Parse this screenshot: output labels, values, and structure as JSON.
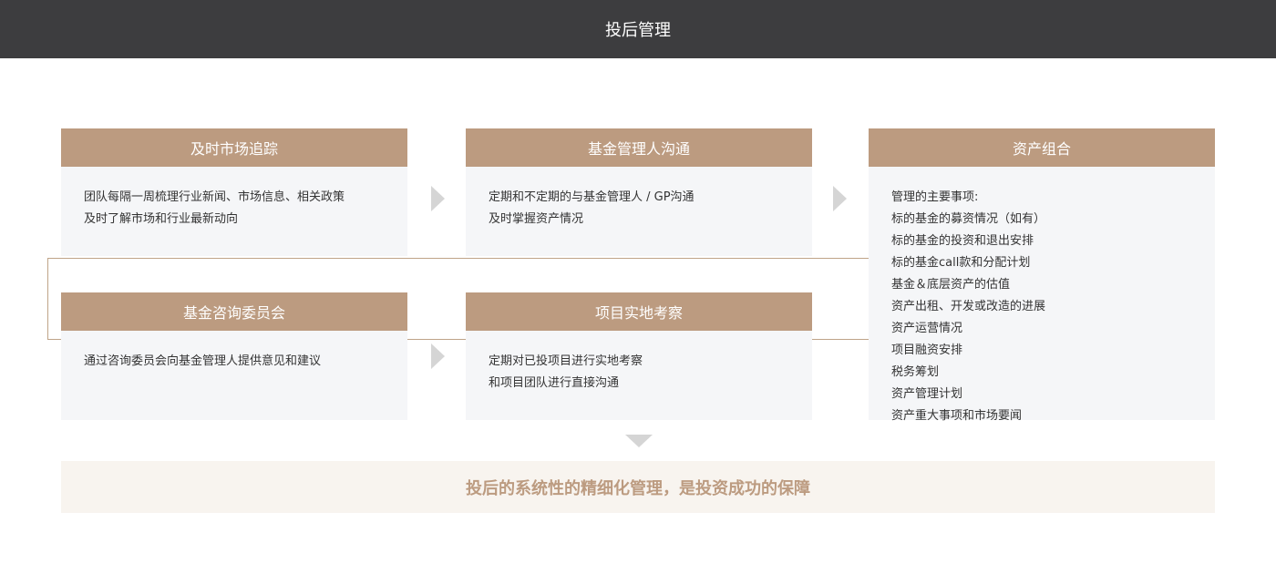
{
  "header": {
    "title": "投后管理"
  },
  "cards": {
    "market": {
      "title": "及时市场追踪",
      "lines": [
        "团队每隔一周梳理行业新闻、市场信息、相关政策",
        "及时了解市场和行业最新动向"
      ]
    },
    "gp": {
      "title": "基金管理人沟通",
      "lines": [
        "定期和不定期的与基金管理人 / GP沟通",
        "及时掌握资产情况"
      ]
    },
    "assets": {
      "title": "资产组合",
      "lines": [
        "管理的主要事项:",
        "标的基金的募资情况（如有）",
        "标的基金的投资和退出安排",
        "标的基金call款和分配计划",
        "基金＆底层资产的估值",
        "资产出租、开发或改造的进展",
        "资产运营情况",
        "项目融资安排",
        "税务筹划",
        "资产管理计划",
        "资产重大事项和市场要闻"
      ]
    },
    "advisory": {
      "title": "基金咨询委员会",
      "lines": [
        "通过咨询委员会向基金管理人提供意见和建议"
      ]
    },
    "site": {
      "title": "项目实地考察",
      "lines": [
        "定期对已投项目进行实地考察",
        "和项目团队进行直接沟通"
      ]
    }
  },
  "footer": {
    "text": "投后的系统性的精细化管理，是投资成功的保障"
  },
  "colors": {
    "header_bg": "#3d3d3f",
    "card_head_bg": "#bc9b80",
    "card_body_bg": "#f5f6f8",
    "footer_bg": "#f8f4ef",
    "footer_text": "#bc9b80",
    "arrow": "#d5d5d5"
  }
}
